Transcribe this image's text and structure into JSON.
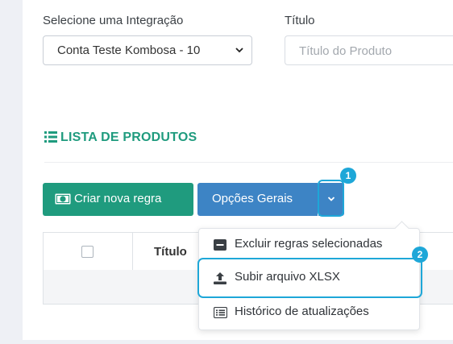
{
  "filters": {
    "integration_label": "Selecione uma Integração",
    "integration_value": "Conta Teste Kombosa - 10",
    "title_label": "Título",
    "title_placeholder": "Título do Produto"
  },
  "section": {
    "title": "LISTA DE PRODUTOS"
  },
  "toolbar": {
    "create_rule": "Criar nova regra",
    "general_options": "Opções Gerais"
  },
  "table": {
    "columns": [
      "",
      "Título"
    ]
  },
  "dropdown": {
    "items": [
      {
        "label": "Excluir regras selecionadas",
        "icon": "minus-square-icon"
      },
      {
        "label": "Subir arquivo XLSX",
        "icon": "upload-icon"
      },
      {
        "label": "Histórico de atualizações",
        "icon": "list-icon"
      }
    ]
  },
  "annotations": {
    "badge1": "1",
    "badge2": "2",
    "color": "#1ea7d8"
  },
  "colors": {
    "green": "#1f9b7e",
    "blue": "#3d84c5"
  }
}
